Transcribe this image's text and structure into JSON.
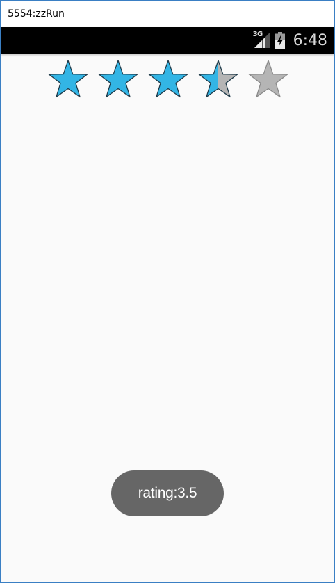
{
  "window": {
    "title": "5554:zzRun"
  },
  "status_bar": {
    "network_label": "3G",
    "network_icon": "signal-icon",
    "battery_icon": "battery-charging-icon",
    "time": "6:48"
  },
  "rating_bar": {
    "max": 5,
    "rating": 3.5,
    "filled_color": "#33b5e5",
    "empty_color": "#b5b5b5",
    "star_icon": "star-icon"
  },
  "toast": {
    "text": "rating:3.5"
  }
}
